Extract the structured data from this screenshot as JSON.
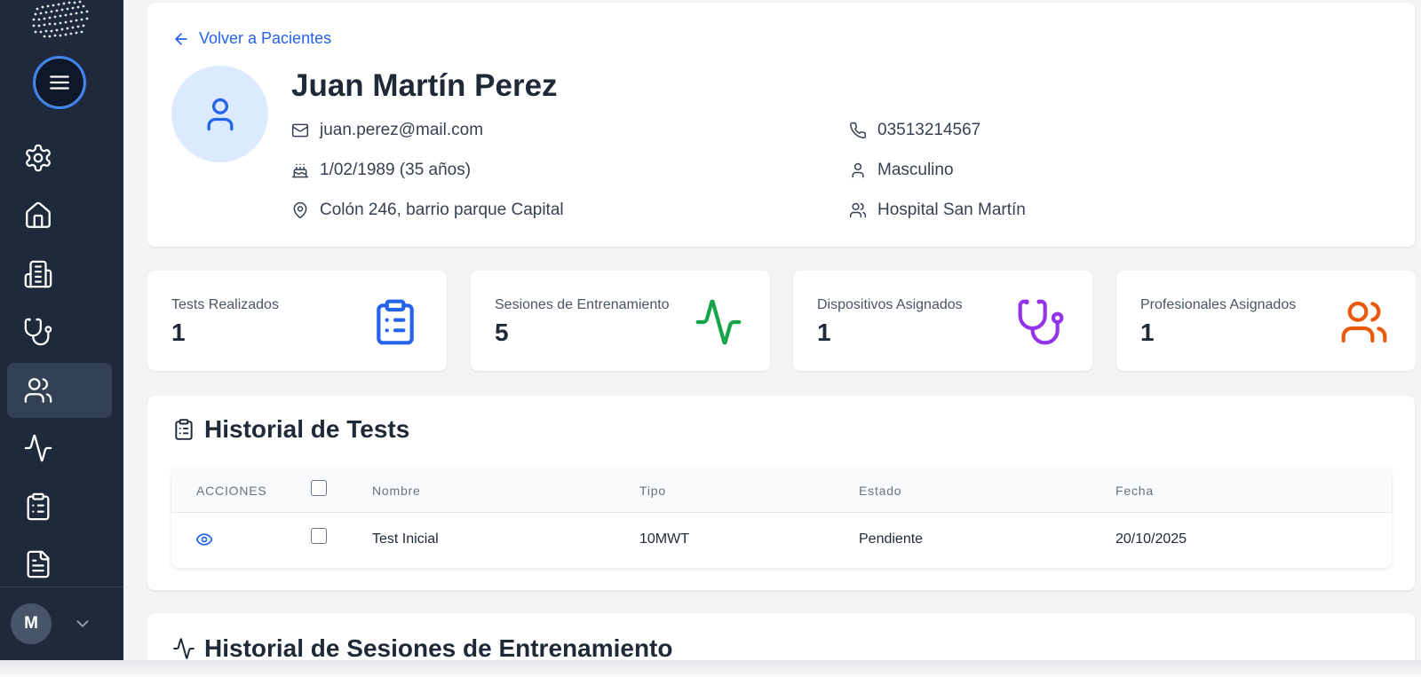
{
  "back_link": "Volver a Pacientes",
  "patient": {
    "name": "Juan Martín Perez",
    "email": "juan.perez@mail.com",
    "birthdate": "1/02/1989 (35 años)",
    "address": "Colón 246, barrio parque Capital",
    "phone": "03513214567",
    "gender": "Masculino",
    "institution": "Hospital San Martín"
  },
  "stats": [
    {
      "label": "Tests Realizados",
      "value": "1",
      "icon": "clipboard-list-icon",
      "color": "#2563eb"
    },
    {
      "label": "Sesiones de Entrenamiento",
      "value": "5",
      "icon": "activity-icon",
      "color": "#16a34a"
    },
    {
      "label": "Dispositivos Asignados",
      "value": "1",
      "icon": "stethoscope-icon",
      "color": "#9333ea"
    },
    {
      "label": "Profesionales Asignados",
      "value": "1",
      "icon": "users-icon",
      "color": "#ea580c"
    }
  ],
  "tests_section": {
    "title": "Historial de Tests",
    "columns": [
      "ACCIONES",
      "Nombre",
      "Tipo",
      "Estado",
      "Fecha"
    ],
    "rows": [
      {
        "nombre": "Test Inicial",
        "tipo": "10MWT",
        "estado": "Pendiente",
        "fecha": "20/10/2025"
      }
    ]
  },
  "sessions_section": {
    "title": "Historial de Sesiones de Entrenamiento"
  },
  "user": {
    "initial": "M"
  },
  "sidebar": {
    "items": [
      {
        "icon": "settings-icon"
      },
      {
        "icon": "home-icon"
      },
      {
        "icon": "building-icon"
      },
      {
        "icon": "stethoscope-icon"
      },
      {
        "icon": "users-icon",
        "active": true
      },
      {
        "icon": "activity-icon"
      },
      {
        "icon": "clipboard-list-icon"
      },
      {
        "icon": "file-text-icon"
      }
    ]
  },
  "colors": {
    "sidebar": "#1e293b",
    "accent": "#2563eb",
    "active_item": "#334155"
  }
}
